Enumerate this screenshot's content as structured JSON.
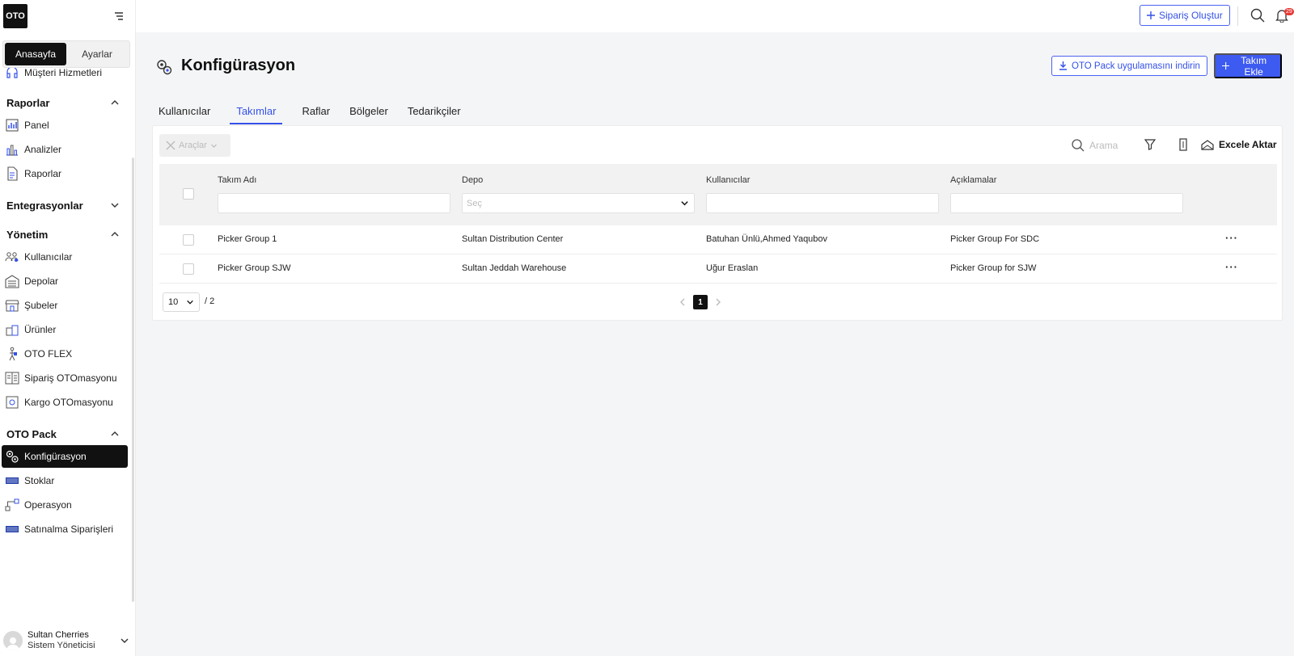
{
  "app": {
    "logo": "OTO"
  },
  "sidebar": {
    "segments": [
      {
        "label": "Anasayfa",
        "active": true
      },
      {
        "label": "Ayarlar",
        "active": false
      }
    ],
    "partial_item": "Müşteri Hizmetleri",
    "sections": [
      {
        "title": "Raporlar",
        "expanded": true,
        "items": [
          "Panel",
          "Analizler",
          "Raporlar"
        ]
      },
      {
        "title": "Entegrasyonlar",
        "expanded": false,
        "items": []
      },
      {
        "title": "Yönetim",
        "expanded": true,
        "items": [
          "Kullanıcılar",
          "Depolar",
          "Şubeler",
          "Ürünler",
          "OTO FLEX",
          "Sipariş OTOmasyonu",
          "Kargo OTOmasyonu"
        ]
      },
      {
        "title": "OTO Pack",
        "expanded": true,
        "items": [
          "Konfigürasyon",
          "Stoklar",
          "Operasyon",
          "Satınalma Siparişleri"
        ]
      }
    ],
    "active_item": "Konfigürasyon",
    "user": {
      "name": "Sultan Cherries",
      "role": "Sistem Yöneticisi"
    }
  },
  "topbar": {
    "create_order": "Sipariş Oluştur",
    "notification_count": "29"
  },
  "header": {
    "title": "Konfigürasyon",
    "download_button": "OTO Pack uygulamasını indirin",
    "add_button": "Takım Ekle"
  },
  "tabs": [
    {
      "label": "Kullanıcılar",
      "active": false
    },
    {
      "label": "Takımlar",
      "active": true
    },
    {
      "label": "Raflar",
      "active": false
    },
    {
      "label": "Bölgeler",
      "active": false
    },
    {
      "label": "Tedarikçiler",
      "active": false
    }
  ],
  "toolbar": {
    "tools": "Araçlar",
    "search_placeholder": "Arama",
    "export": "Excele Aktar"
  },
  "table": {
    "columns": [
      "Takım Adı",
      "Depo",
      "Kullanıcılar",
      "Açıklamalar"
    ],
    "depot_placeholder": "Seç",
    "rows": [
      [
        "Picker Group 1",
        "Sultan Distribution Center",
        "Batuhan Ünlü,Ahmed Yaqubov",
        "Picker Group For SDC"
      ],
      [
        "Picker Group SJW",
        "Sultan Jeddah Warehouse",
        "Uğur Eraslan",
        "Picker Group for SJW"
      ]
    ]
  },
  "pagination": {
    "page_size": "10",
    "total_pages": "/ 2",
    "current_page": "1"
  },
  "colors": {
    "accent": "#3d5af1",
    "dark": "#111111",
    "badge": "#e53935"
  }
}
